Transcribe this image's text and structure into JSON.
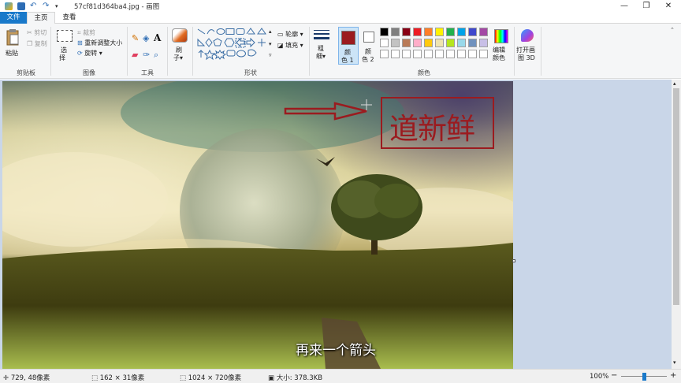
{
  "window": {
    "title": "57cf81d364ba4.jpg - 画图",
    "minimize": "—",
    "maximize": "❐",
    "close": "✕"
  },
  "tabs": {
    "file": "文件",
    "home": "主页",
    "view": "查看"
  },
  "clipboard": {
    "paste": "粘贴",
    "cut": "剪切",
    "copy": "复制",
    "group": "剪贴板"
  },
  "image": {
    "select": "选",
    "select2": "择",
    "crop": "裁剪",
    "resize": "重新调整大小",
    "rotate": "旋转",
    "group": "图像"
  },
  "tools": {
    "group": "工具"
  },
  "brushes": {
    "label": "刷",
    "label2": "子"
  },
  "shapes": {
    "outline": "轮廓",
    "fill": "填充",
    "group": "形状"
  },
  "size": {
    "label": "粗",
    "label2": "细"
  },
  "colors": {
    "color1": "颜",
    "color1b": "色 1",
    "color2": "颜",
    "color2b": "色 2",
    "group": "颜色",
    "edit": "编辑",
    "edit2": "颜色",
    "paint3d": "打开画",
    "paint3d2": "图 3D",
    "color1_value": "#9b1b1f",
    "color2_value": "#ffffff",
    "palette_row1": [
      "#000000",
      "#7f7f7f",
      "#880015",
      "#ed1c24",
      "#ff7f27",
      "#fff200",
      "#22b14c",
      "#00a2e8",
      "#3f48cc",
      "#a349a4"
    ],
    "palette_row2": [
      "#ffffff",
      "#c3c3c3",
      "#b97a57",
      "#ffaec9",
      "#ffc90e",
      "#efe4b0",
      "#b5e61d",
      "#99d9ea",
      "#7092be",
      "#c8bfe7"
    ]
  },
  "canvas": {
    "stamp_text": "道新鲜",
    "subtitle": "再来一个箭头"
  },
  "status": {
    "cursor": "729, 48像素",
    "selection": "162 × 31像素",
    "dimensions": "1024 × 720像素",
    "filesize": "大小: 378.3KB",
    "zoom": "100%",
    "zoom_out": "−",
    "zoom_in": "+",
    "zoom_level": 0.5
  }
}
